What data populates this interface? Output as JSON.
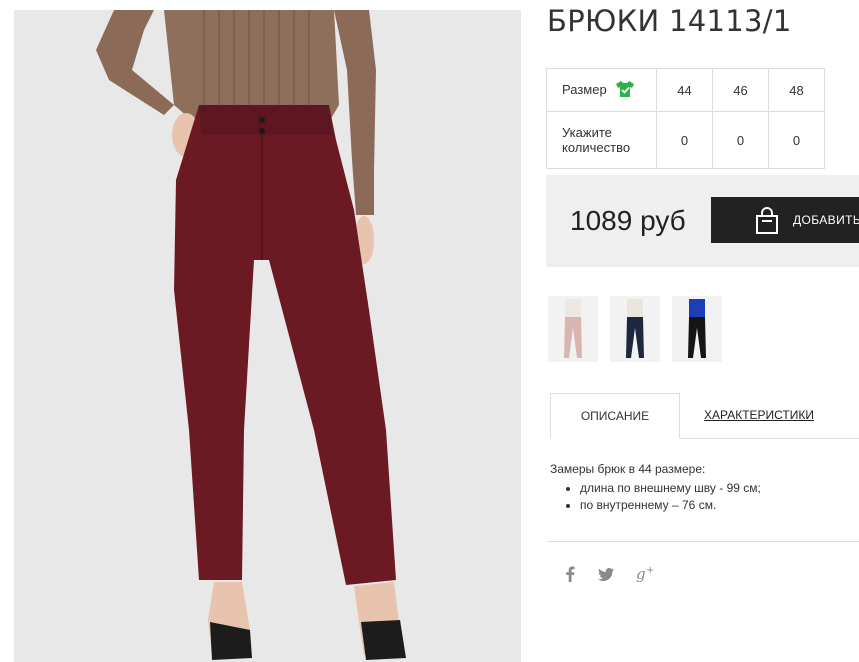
{
  "product": {
    "title": "БРЮКИ 14113/1"
  },
  "sizes": {
    "size_label": "Размер",
    "qty_label_line1": "Укажите",
    "qty_label_line2": "количество",
    "items": [
      {
        "size": "44",
        "qty": "0"
      },
      {
        "size": "46",
        "qty": "0"
      },
      {
        "size": "48",
        "qty": "0"
      }
    ],
    "icon": "tshirt-check-icon",
    "icon_color": "#2bb34a"
  },
  "purchase": {
    "price": "1089 руб",
    "add_label": "ДОБАВИТЬ",
    "icon": "shopping-bag-icon"
  },
  "thumbnails": [
    {
      "name": "thumbnail-pink-trousers",
      "top": "#ece7e2",
      "bottom": "#d9b5b1"
    },
    {
      "name": "thumbnail-navy-trousers",
      "top": "#eae6dc",
      "bottom": "#1d2740"
    },
    {
      "name": "thumbnail-black-trousers",
      "top": "#1b3fb8",
      "bottom": "#151515"
    }
  ],
  "tabs": {
    "description": "ОПИСАНИЕ",
    "specs": "ХАРАКТЕРИСТИКИ"
  },
  "description": {
    "intro": "Замеры брюк в 44 размере:",
    "bullets": [
      "длина по внешнему шву - 99 см;",
      "по внутреннему – 76 см."
    ]
  },
  "social": {
    "facebook": "f",
    "twitter": "🐦",
    "googleplus": "g+"
  },
  "colors": {
    "trousers": "#6b1a24",
    "top": "#8a6a55",
    "button": "#222222"
  }
}
